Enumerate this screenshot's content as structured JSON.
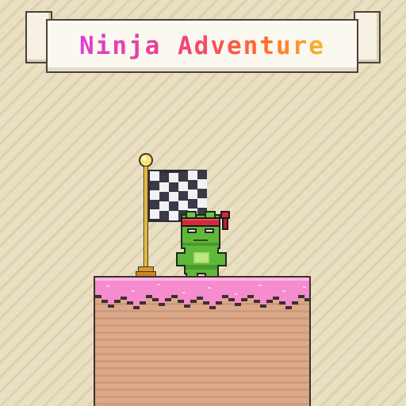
{
  "game": {
    "title": "Ninja Adventure"
  },
  "colors": {
    "background": "#e7dcbd",
    "frosting": "#f58ccd",
    "dirt": "#dba98a",
    "frog": "#5fb83a",
    "headband": "#d4283d",
    "pole": "#e0b43a"
  },
  "icons": {
    "goal": "checkered-flag-icon",
    "player": "ninja-frog",
    "terrain": "frosted-dirt-platform"
  }
}
